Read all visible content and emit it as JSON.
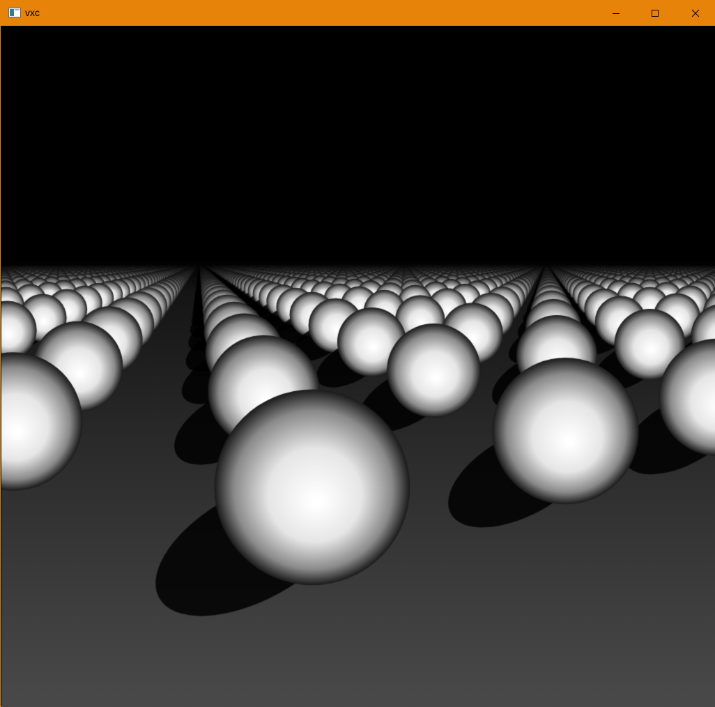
{
  "window": {
    "title": "vxc",
    "titlebar_color": "#e8830a",
    "controls": {
      "minimize_icon": "minimize-icon",
      "maximize_icon": "maximize-icon",
      "close_icon": "close-icon"
    }
  },
  "scene": {
    "description_icon": "sphere-grid-render",
    "background_color": "#000000",
    "floor_color": "#4a4a4a",
    "sphere_color": "#ffffff"
  }
}
